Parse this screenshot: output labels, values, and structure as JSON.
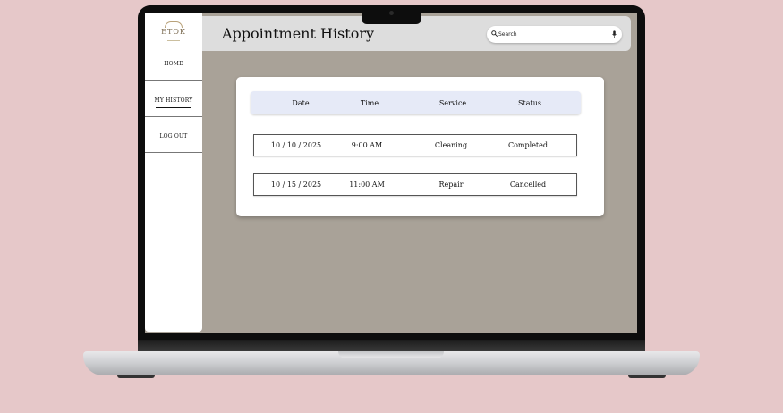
{
  "sidebar": {
    "logo_text": "ETOK",
    "items": [
      {
        "label": "HOME"
      },
      {
        "label": "MY HISTORY"
      },
      {
        "label": "LOG OUT"
      }
    ],
    "active": "MY HISTORY"
  },
  "header": {
    "title": "Appointment History",
    "search": {
      "placeholder": "Search",
      "value": ""
    }
  },
  "table": {
    "columns": [
      "Date",
      "Time",
      "Service",
      "Status"
    ],
    "rows": [
      {
        "date": "10 / 10 / 2025",
        "time": "9:00 AM",
        "service": "Cleaning",
        "status": "Completed"
      },
      {
        "date": "10 / 15 / 2025",
        "time": "11:00 AM",
        "service": "Repair",
        "status": "Cancelled"
      }
    ]
  },
  "colors": {
    "background": "#e6c8c9",
    "screen": "#a9a298",
    "topbar": "#dddddd",
    "table_header": "#e6eaf7",
    "logo_accent": "#b9a27a"
  }
}
